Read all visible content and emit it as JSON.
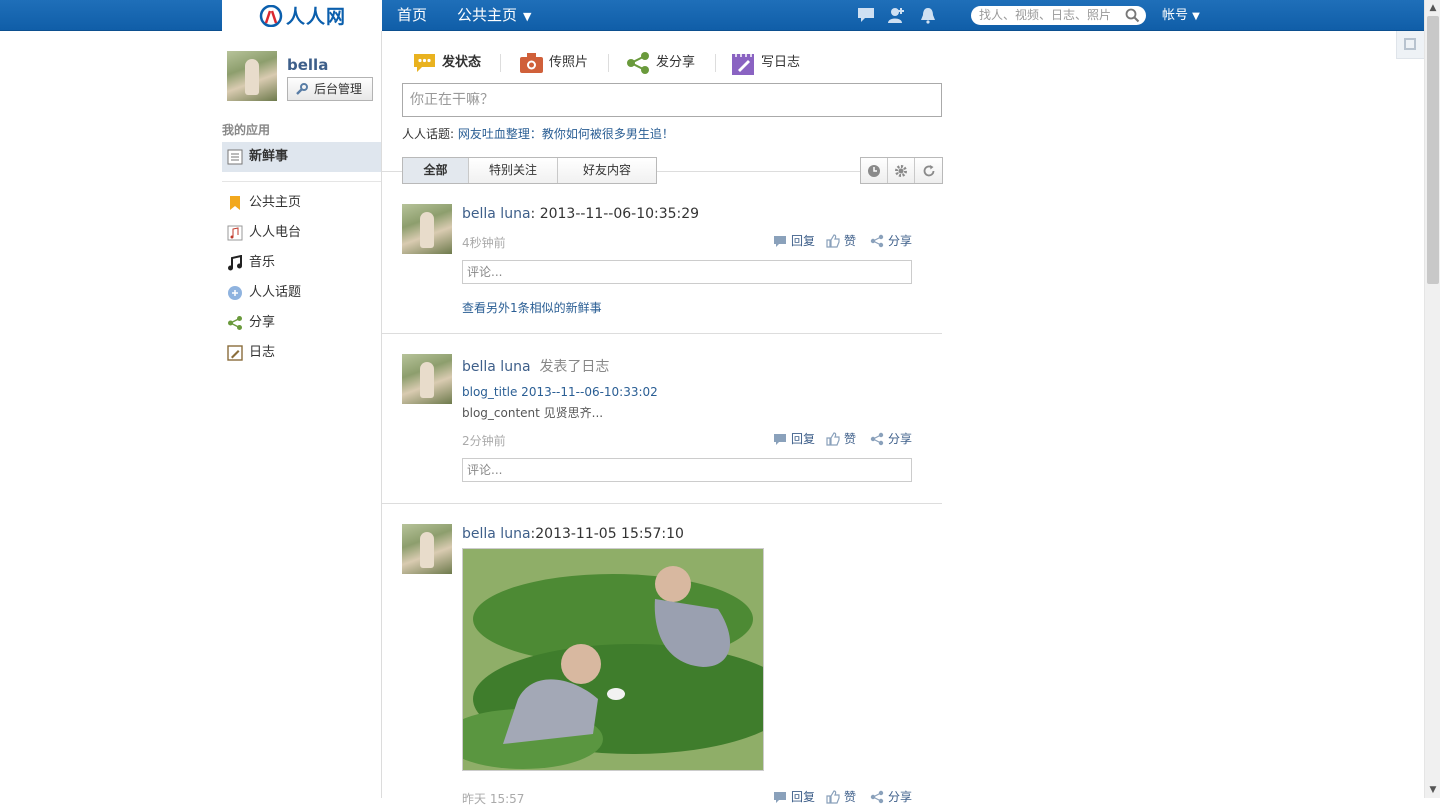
{
  "topbar": {
    "logo_text": "人人网",
    "nav_home": "首页",
    "nav_public": "公共主页",
    "search_placeholder": "找人、视频、日志、照片",
    "account": "帐号"
  },
  "sidebar": {
    "user_name": "bella",
    "admin_button": "后台管理",
    "section_title": "我的应用",
    "active_item": "新鲜事",
    "items": [
      {
        "label": "公共主页",
        "icon": "bookmark-icon"
      },
      {
        "label": "人人电台",
        "icon": "radio-icon"
      },
      {
        "label": "音乐",
        "icon": "music-note-icon"
      },
      {
        "label": "人人话题",
        "icon": "topic-icon"
      },
      {
        "label": "分享",
        "icon": "share-icon"
      },
      {
        "label": "日志",
        "icon": "blog-icon"
      }
    ]
  },
  "publisher": {
    "tabs": [
      {
        "label": "发状态",
        "icon": "speech-bubble-icon"
      },
      {
        "label": "传照片",
        "icon": "camera-icon"
      },
      {
        "label": "发分享",
        "icon": "share-icon"
      },
      {
        "label": "写日志",
        "icon": "notepad-icon"
      }
    ],
    "placeholder": "你正在干嘛？",
    "topic_label": "人人话题:",
    "topic_link": "网友吐血整理：教你如何被很多男生追！"
  },
  "filter": {
    "tabs": [
      "全部",
      "特别关注",
      "好友内容"
    ],
    "active": "全部"
  },
  "actions": {
    "reply": "回复",
    "like": "赞",
    "share": "分享",
    "comment_placeholder": "评论..."
  },
  "feed": [
    {
      "name": "bella luna",
      "text": ": 2013--11--06-10:35:29",
      "time": "4秒钟前",
      "more": "查看另外1条相似的新鲜事"
    },
    {
      "name": "bella luna",
      "verb": "发表了日志",
      "blog_title": "blog_title 2013--11--06-10:33:02",
      "blog_content": "blog_content 见贤思齐...",
      "time": "2分钟前"
    },
    {
      "name": "bella luna",
      "text": ":2013-11-05 15:57:10",
      "time": "昨天 15:57"
    }
  ],
  "colors": {
    "topbar": "#1a69b4",
    "link": "#3e5f8a",
    "sidebar_active": "#dfe6ee"
  }
}
